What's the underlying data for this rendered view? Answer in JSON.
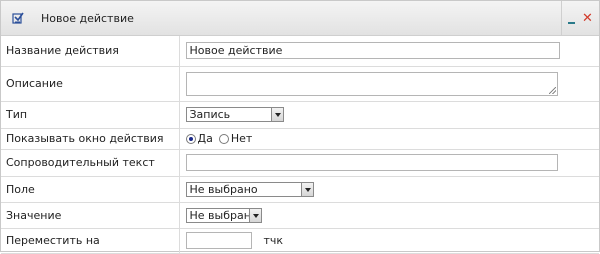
{
  "window": {
    "title": "Новое действие",
    "icon": "action-icon",
    "minimize_icon": "minimize-icon",
    "close_icon": "close-icon",
    "close_glyph": "✕"
  },
  "form": {
    "name": {
      "label": "Название действия",
      "value": "Новое действие"
    },
    "description": {
      "label": "Описание",
      "value": ""
    },
    "type": {
      "label": "Тип",
      "value": "Запись"
    },
    "show_window": {
      "label": "Показывать окно действия",
      "options": [
        {
          "label": "Да",
          "selected": true
        },
        {
          "label": "Нет",
          "selected": false
        }
      ]
    },
    "accompanying_text": {
      "label": "Сопроводительный текст",
      "value": ""
    },
    "field": {
      "label": "Поле",
      "value": "Не выбрано"
    },
    "value": {
      "label": "Значение",
      "value": "Не выбрано"
    },
    "move_to": {
      "label": "Переместить на",
      "value": "",
      "unit": "тчк"
    }
  },
  "colors": {
    "close": "#d23a2a",
    "minimize": "#2a7a8a",
    "radio_dot": "#1b2a8a"
  }
}
